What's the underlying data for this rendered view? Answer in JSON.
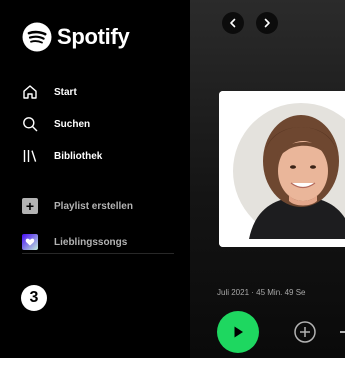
{
  "app": {
    "name": "Spotify"
  },
  "sidebar": {
    "nav": [
      {
        "label": "Start",
        "icon": "home-icon"
      },
      {
        "label": "Suchen",
        "icon": "search-icon"
      },
      {
        "label": "Bibliothek",
        "icon": "library-icon"
      }
    ],
    "actions": [
      {
        "label": "Playlist erstellen",
        "icon": "plus-icon"
      },
      {
        "label": "Lieblingssongs",
        "icon": "heart-icon"
      }
    ]
  },
  "annotation": {
    "step_number": "3"
  },
  "main": {
    "meta_text": "Juli 2021 · 45 Min. 49 Se"
  },
  "colors": {
    "accent": "#1ed760",
    "background": "#000000",
    "text_secondary": "#b3b3b3"
  }
}
